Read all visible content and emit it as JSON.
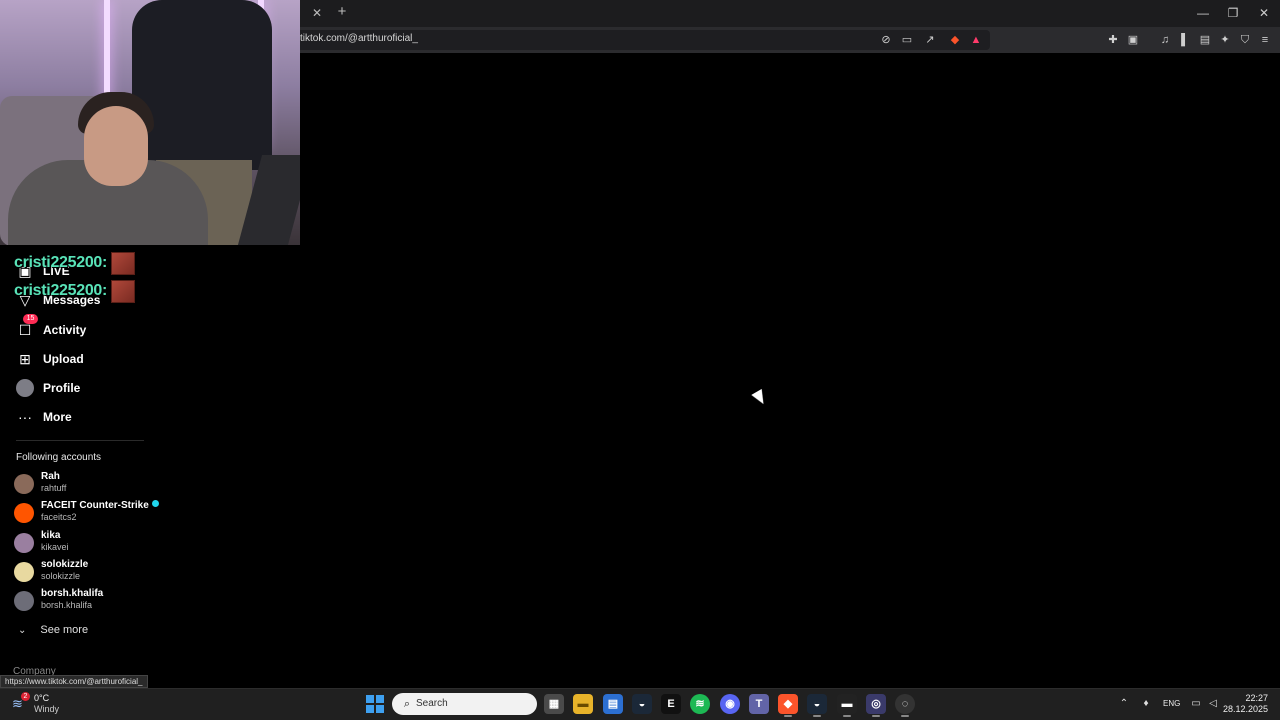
{
  "browser": {
    "tab_close": "✕",
    "new_tab": "+",
    "url": "tiktok.com/@artthuroficial_",
    "window_controls": {
      "minimize": "—",
      "restore": "❐",
      "close": "✕"
    }
  },
  "sidebar": {
    "nav": [
      {
        "label": "LIVE",
        "icon": "live-icon"
      },
      {
        "label": "Messages",
        "icon": "messages-icon"
      },
      {
        "label": "Activity",
        "icon": "activity-icon",
        "badge": "15"
      },
      {
        "label": "Upload",
        "icon": "upload-icon"
      },
      {
        "label": "Profile",
        "icon": "profile-avatar"
      },
      {
        "label": "More",
        "icon": "more-icon"
      }
    ],
    "following_title": "Following accounts",
    "accounts": [
      {
        "name": "Rah",
        "handle": "rahtuff",
        "avatar_color": "#8a6a5a"
      },
      {
        "name": "FACEIT Counter-Strike",
        "handle": "faceitcs2",
        "avatar_color": "#ff5500",
        "verified": true
      },
      {
        "name": "kika",
        "handle": "kikavei",
        "avatar_color": "#9a7fa0"
      },
      {
        "name": "solokizzle",
        "handle": "solokizzle",
        "avatar_color": "#e8d9a0"
      },
      {
        "name": "borsh.khalifa",
        "handle": "borsh.khalifa",
        "avatar_color": "#6d6d78"
      }
    ],
    "see_more": "See more",
    "company": "Company"
  },
  "chat": {
    "lines": [
      {
        "user": "cristi225200:"
      },
      {
        "user": "cristi225200:"
      }
    ]
  },
  "status_tooltip": "https://www.tiktok.com/@artthuroficial_",
  "taskbar": {
    "weather_badge": "2",
    "weather_temp": "0°C",
    "weather_desc": "Windy",
    "search_placeholder": "Search",
    "language": "ENG",
    "time": "22:27",
    "date": "28.12.2025"
  }
}
